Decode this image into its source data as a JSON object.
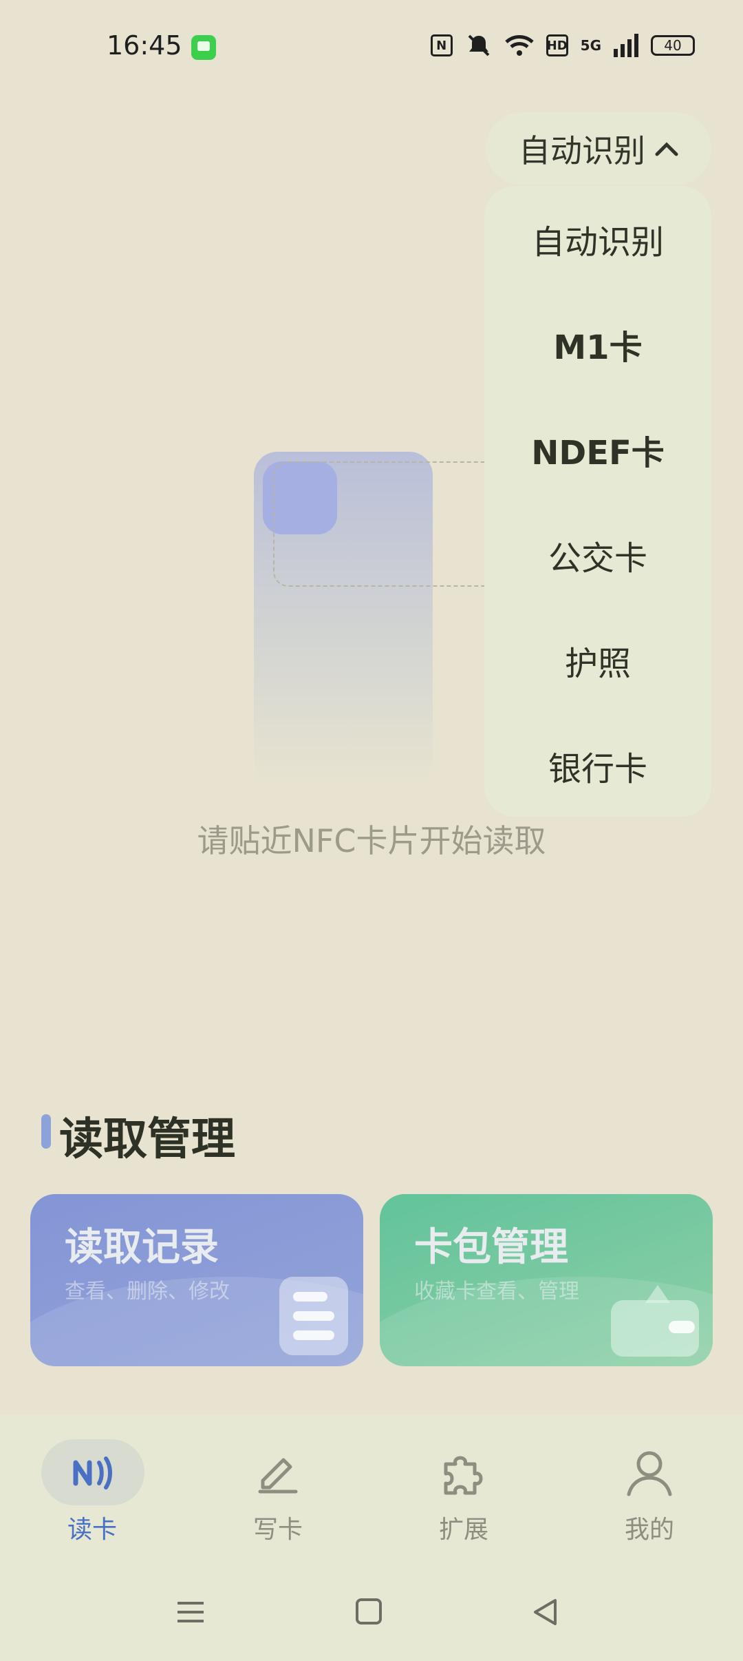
{
  "status_bar": {
    "time": "16:45",
    "network": "5G",
    "battery": "40",
    "icons": [
      "message-icon",
      "nfc-icon",
      "mute-icon",
      "wifi-icon",
      "hd-icon",
      "signal-icon",
      "battery-icon"
    ]
  },
  "mode_selector": {
    "selected": "自动识别",
    "options": [
      "自动识别",
      "M1卡",
      "NDEF卡",
      "公交卡",
      "护照",
      "银行卡"
    ]
  },
  "hint": "请贴近NFC卡片开始读取",
  "section": {
    "title": "读取管理",
    "cards": [
      {
        "title": "读取记录",
        "subtitle": "查看、删除、修改"
      },
      {
        "title": "卡包管理",
        "subtitle": "收藏卡查看、管理"
      }
    ]
  },
  "bottom_nav": {
    "items": [
      {
        "label": "读卡",
        "icon": "nfc-read-icon"
      },
      {
        "label": "写卡",
        "icon": "pen-icon"
      },
      {
        "label": "扩展",
        "icon": "puzzle-icon"
      },
      {
        "label": "我的",
        "icon": "user-icon"
      }
    ],
    "active": "读卡"
  },
  "colors": {
    "background": "#e8e3d0",
    "accent": "#4a70c4",
    "card_blue": "#8395d6",
    "card_green": "#62c39a"
  }
}
